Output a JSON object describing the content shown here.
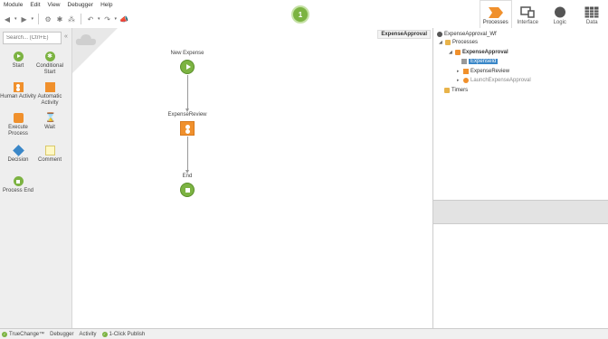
{
  "menu": [
    "Module",
    "Edit",
    "View",
    "Debugger",
    "Help"
  ],
  "publish_badge": "1",
  "tabs": [
    {
      "label": "Processes",
      "icon": "processes-icon",
      "active": true
    },
    {
      "label": "Interface",
      "icon": "interface-icon",
      "active": false
    },
    {
      "label": "Logic",
      "icon": "logic-icon",
      "active": false
    },
    {
      "label": "Data",
      "icon": "data-icon",
      "active": false
    }
  ],
  "toolbox": {
    "search_placeholder": "Search... (Ctrl+E)",
    "items": [
      {
        "label": "Start"
      },
      {
        "label": "Conditional Start"
      },
      {
        "label": "Human Activity"
      },
      {
        "label": "Automatic Activity"
      },
      {
        "label": "Execute Process"
      },
      {
        "label": "Wait"
      },
      {
        "label": "Decision"
      },
      {
        "label": "Comment"
      },
      {
        "label": "Process End"
      }
    ]
  },
  "canvas": {
    "tag": "ExpenseApproval",
    "nodes": {
      "start": "New Expense",
      "review": "ExpenseReview",
      "end": "End"
    }
  },
  "tree": {
    "root": "ExpenseApproval_Wf",
    "processes": "Processes",
    "process": "ExpenseApproval",
    "var": "ExpenseId",
    "activity": "ExpenseReview",
    "launch": "LaunchExpenseApproval",
    "timers": "Timers"
  },
  "bottom": {
    "truechange": "TrueChange™",
    "debugger": "Debugger",
    "activity": "Activity",
    "publish": "1-Click Publish"
  },
  "colors": {
    "accent_orange": "#f0902c",
    "accent_green": "#7cb342",
    "selection_blue": "#3a87c8"
  }
}
